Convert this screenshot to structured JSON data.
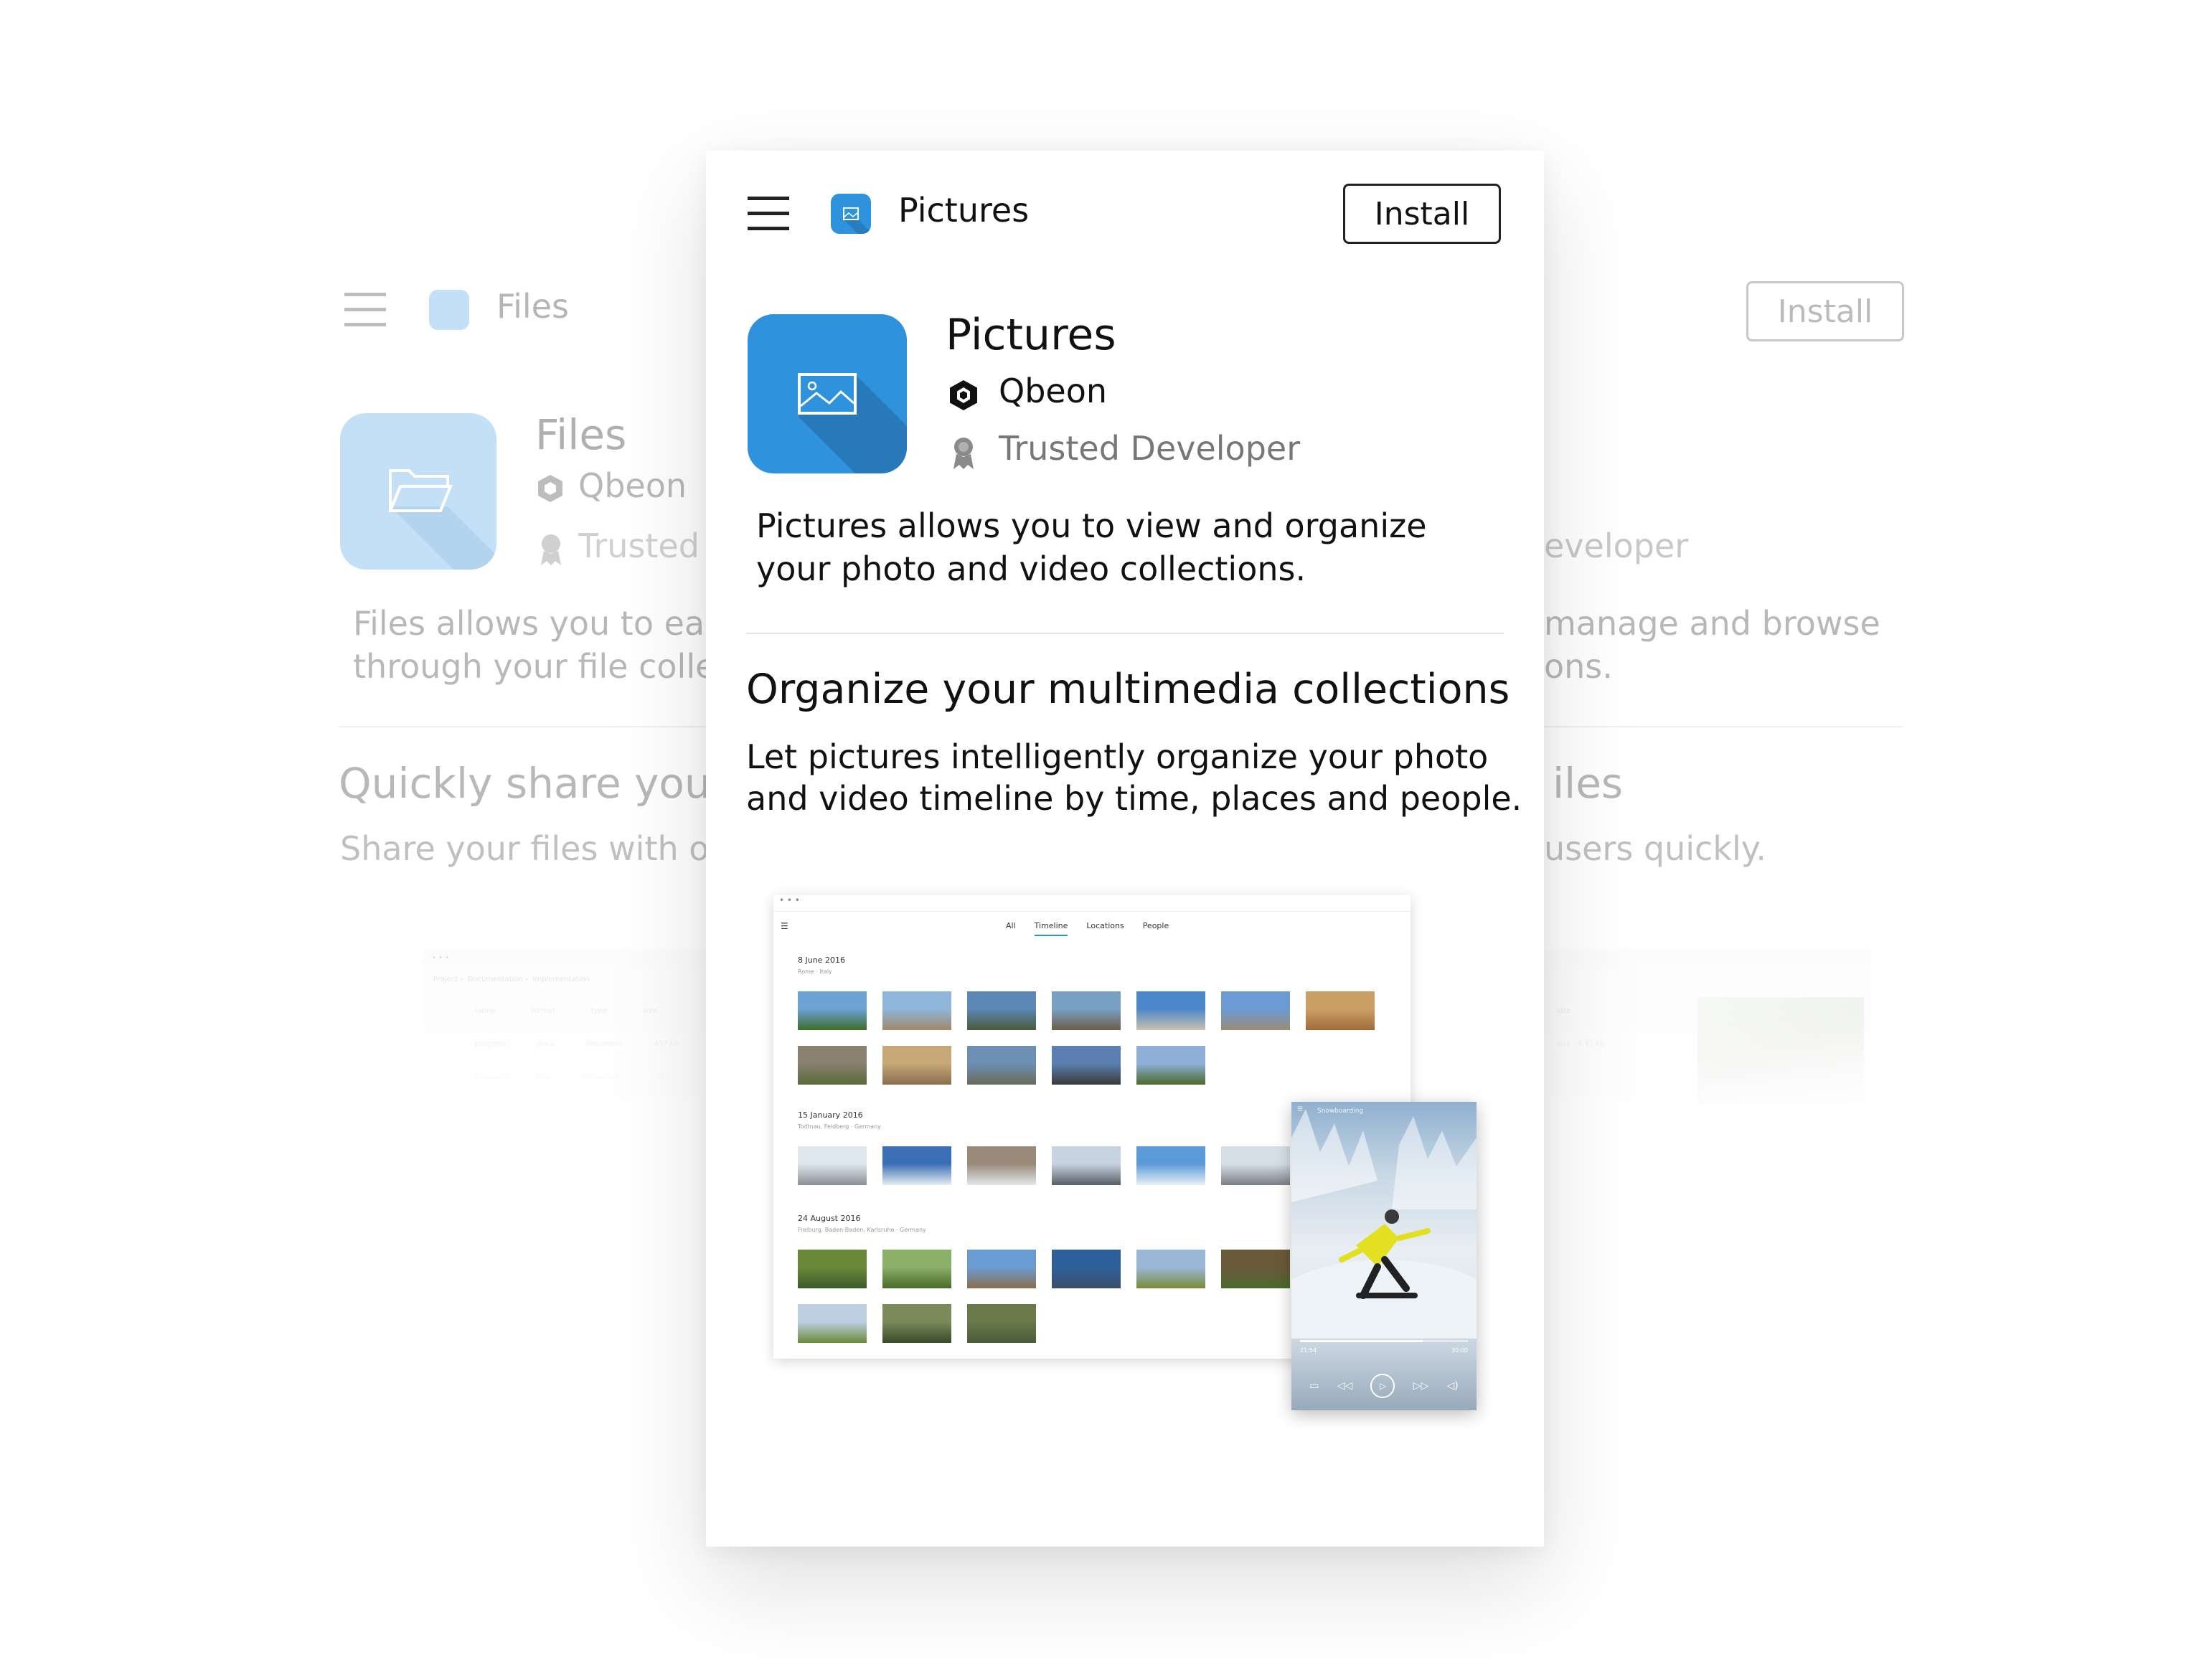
{
  "front": {
    "title": "Pictures",
    "install_label": "Install",
    "app_name": "Pictures",
    "developer": "Qbeon",
    "badge": "Trusted Developer",
    "description_line1": "Pictures allows you to view and organize",
    "description_line2": "your photo and video collections.",
    "feature_heading": "Organize your multimedia collections",
    "feature_line1": "Let pictures intelligently organize your photo",
    "feature_line2": "and video timeline by time, places and people.",
    "screenshot": {
      "tabs": [
        "All",
        "Timeline",
        "Locations",
        "People"
      ],
      "groups": [
        {
          "date": "8 June 2016",
          "place": "Rome · Italy"
        },
        {
          "date": "15 January 2016",
          "place": "Todtnau, Feldberg · Germany"
        },
        {
          "date": "24 August 2016",
          "place": "Freiburg, Baden-Baden, Karlsruhe · Germany"
        }
      ],
      "player": {
        "title": "Snowboarding",
        "time_current": "21:54",
        "time_total": "30:00"
      }
    }
  },
  "back": {
    "title": "Files",
    "install_label": "Install",
    "app_name": "Files",
    "developer": "Qbeon",
    "badge_left": "Trusted",
    "badge_right": "eveloper",
    "desc_left_1": "Files allows you to easil",
    "desc_left_2": "through your file collec",
    "desc_right_1": "manage and browse",
    "desc_right_2": "ons.",
    "heading_left": "Quickly share your",
    "heading_right": "iles",
    "sub_left": "Share your files with oth",
    "sub_right": "users quickly.",
    "mini": {
      "crumbs": [
        "Project",
        "Documentation",
        "Implementation"
      ],
      "columns": [
        "name",
        "format",
        "type",
        "size"
      ],
      "row1": [
        "progress",
        "docx",
        "document",
        "457 kb"
      ],
      "row2": [
        "research",
        "xlsx",
        "document",
        "134 kb"
      ],
      "right_col": "size",
      "right_cell": "size · 4.91 kb"
    }
  },
  "colors": {
    "accent_blue": "#2f92dc",
    "faded_blue": "#c4e0f7",
    "install_border": "#222222"
  }
}
